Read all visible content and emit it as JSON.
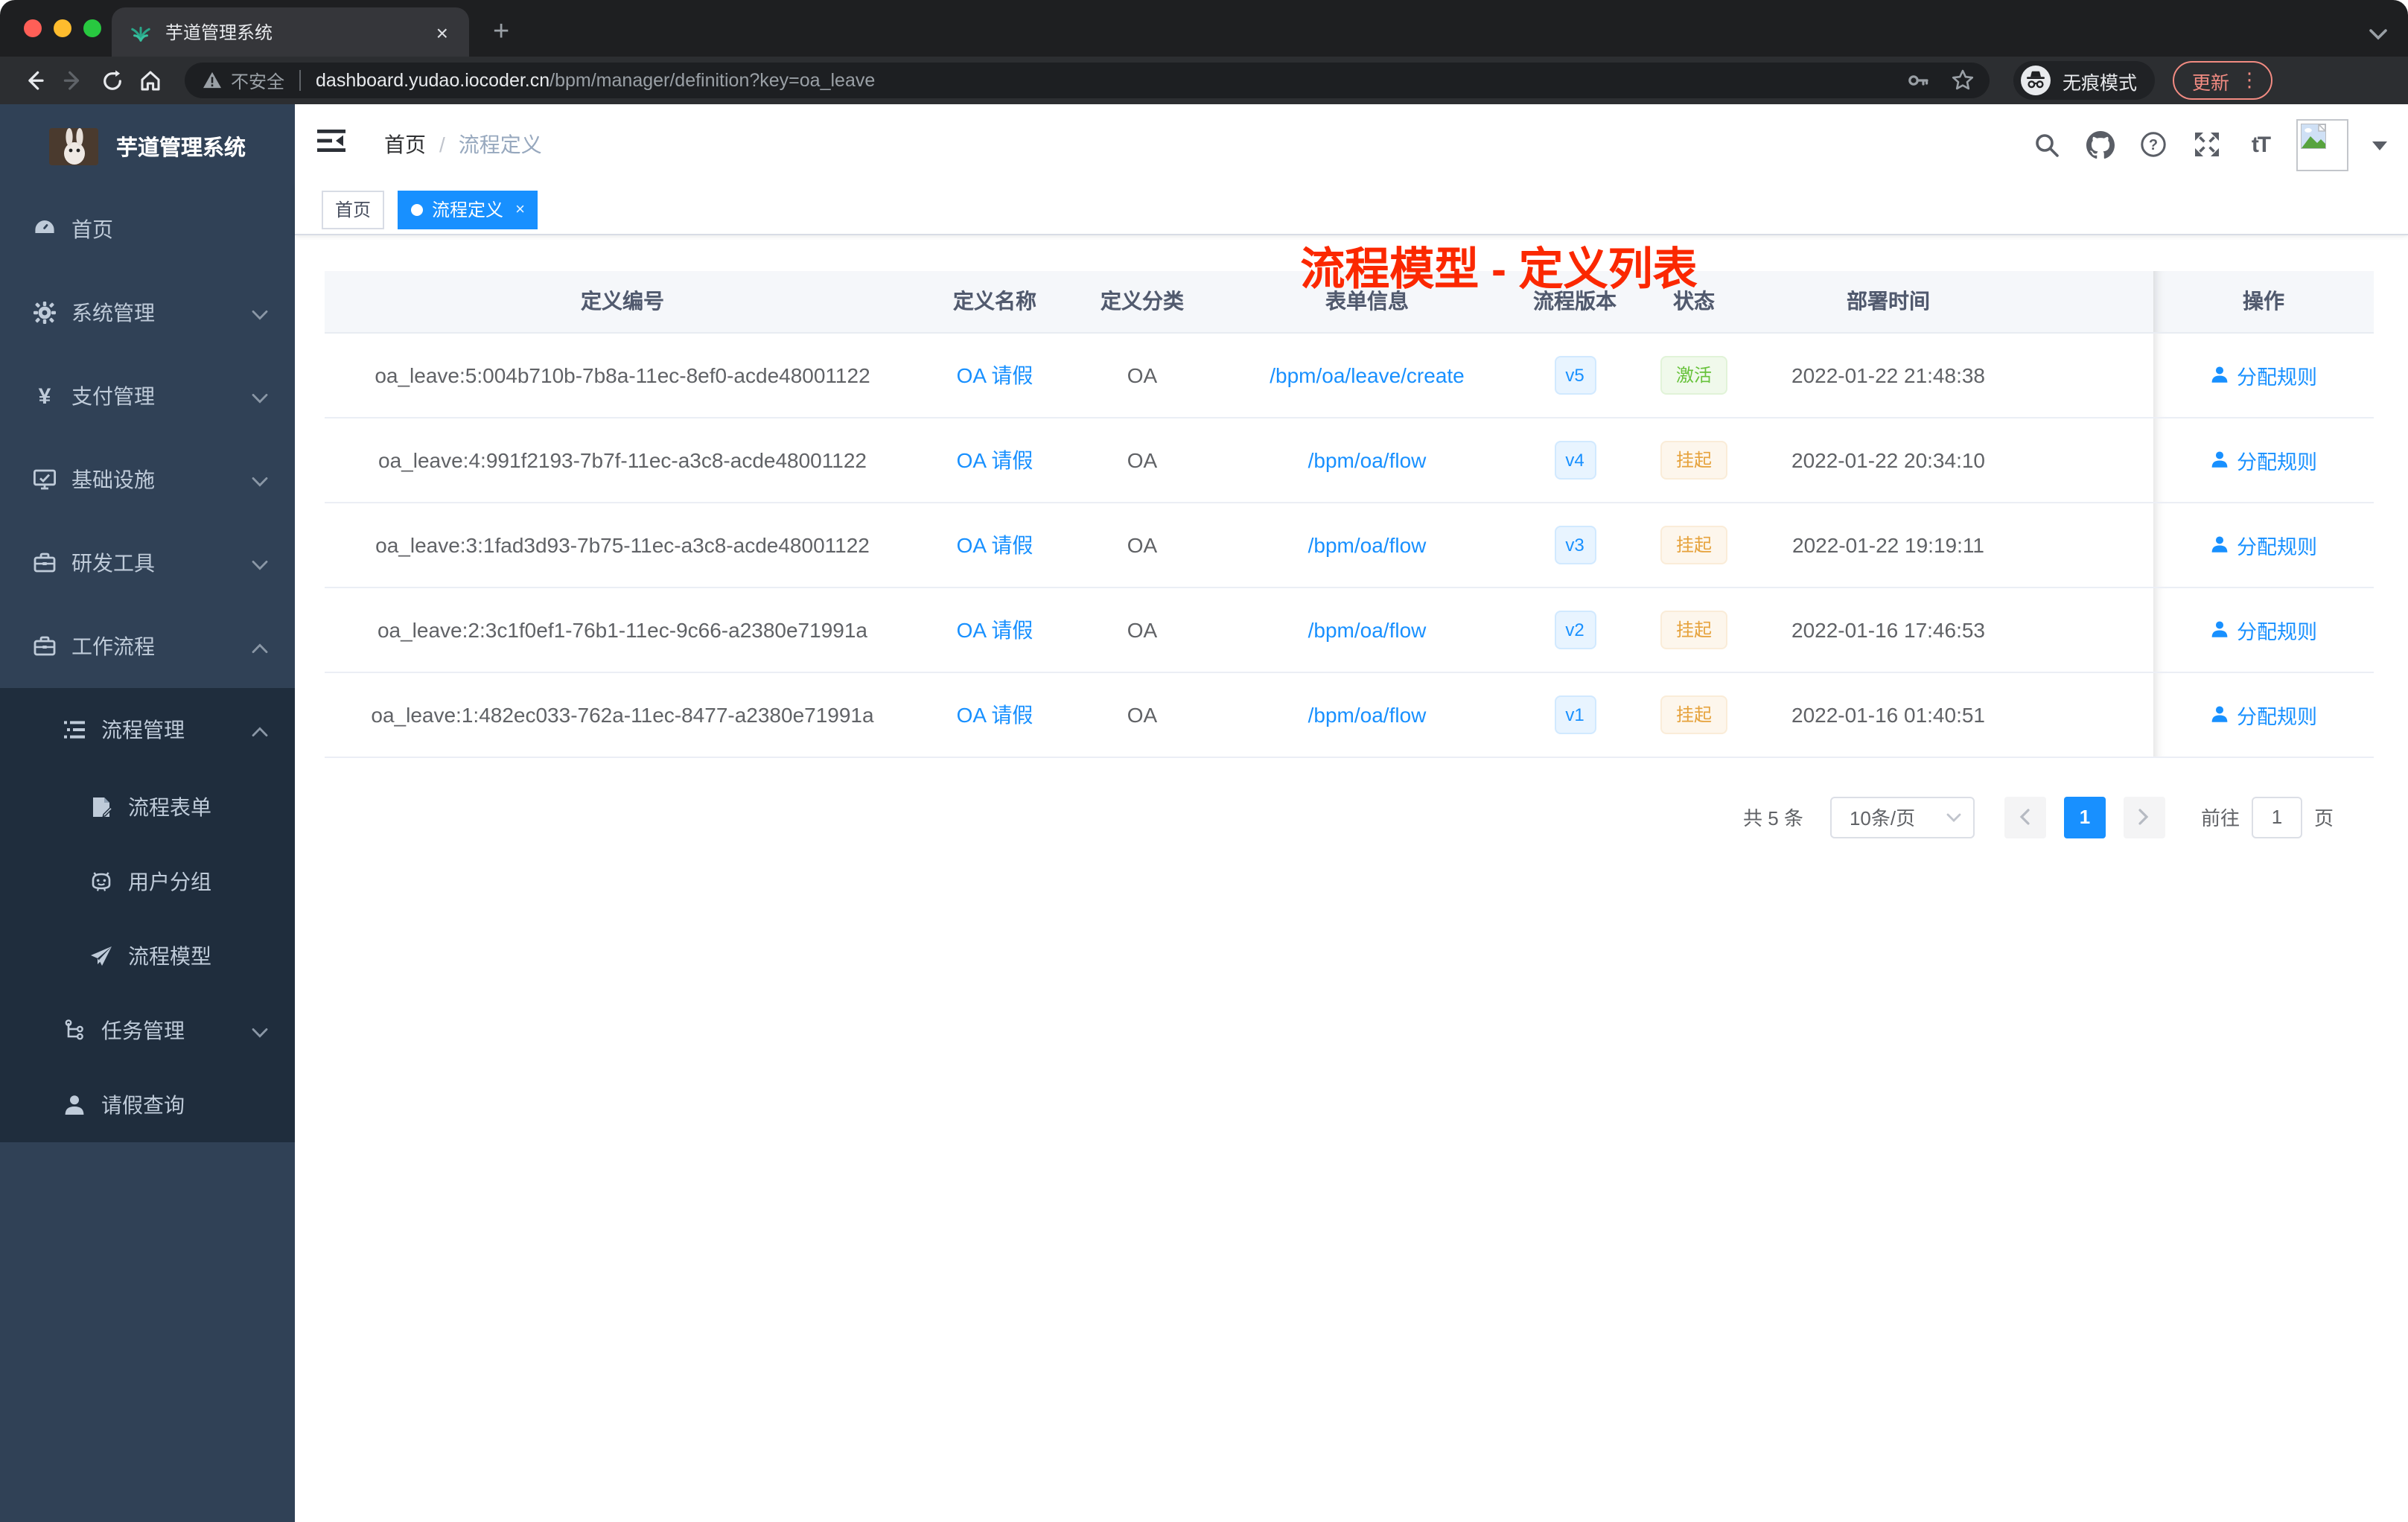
{
  "browser": {
    "tab_title": "芋道管理系统",
    "security_label": "不安全",
    "url_domain": "dashboard.yudao.iocoder.cn",
    "url_path": "/bpm/manager/definition?key=oa_leave",
    "incognito_label": "无痕模式",
    "update_label": "更新"
  },
  "glyphs": {
    "tab_close": "×",
    "new_tab": "+",
    "overflow_dots": "⋮",
    "tag_close": "×",
    "yen": "¥",
    "font_size": "tT"
  },
  "sidebar": {
    "brand": "芋道管理系统",
    "items": [
      {
        "label": "首页",
        "icon": "dashboard-icon"
      },
      {
        "label": "系统管理",
        "icon": "gear-icon"
      },
      {
        "label": "支付管理",
        "icon": "yen-icon"
      },
      {
        "label": "基础设施",
        "icon": "monitor-icon"
      },
      {
        "label": "研发工具",
        "icon": "toolbox-icon"
      },
      {
        "label": "工作流程",
        "icon": "toolbox-icon",
        "expanded": true
      },
      {
        "label": "流程管理",
        "icon": "tree-table-icon",
        "expanded": true
      },
      {
        "label": "流程表单",
        "icon": "form-icon"
      },
      {
        "label": "用户分组",
        "icon": "robot-icon"
      },
      {
        "label": "流程模型",
        "icon": "paper-plane-icon"
      },
      {
        "label": "任务管理",
        "icon": "tree-icon"
      },
      {
        "label": "请假查询",
        "icon": "user-icon"
      }
    ]
  },
  "header": {
    "breadcrumb_home": "首页",
    "breadcrumb_sep": "/",
    "breadcrumb_current": "流程定义",
    "annotation": "流程模型 - 定义列表"
  },
  "tags": {
    "home": "首页",
    "active": "流程定义"
  },
  "table": {
    "headers": [
      "定义编号",
      "定义名称",
      "定义分类",
      "表单信息",
      "流程版本",
      "状态",
      "部署时间",
      "操作"
    ],
    "rows": [
      {
        "id": "oa_leave:5:004b710b-7b8a-11ec-8ef0-acde48001122",
        "name": "OA 请假",
        "category": "OA",
        "form": "/bpm/oa/leave/create",
        "version": "v5",
        "status": "激活",
        "status_type": "success",
        "time": "2022-01-22 21:48:38",
        "action": "分配规则"
      },
      {
        "id": "oa_leave:4:991f2193-7b7f-11ec-a3c8-acde48001122",
        "name": "OA 请假",
        "category": "OA",
        "form": "/bpm/oa/flow",
        "version": "v4",
        "status": "挂起",
        "status_type": "warning",
        "time": "2022-01-22 20:34:10",
        "action": "分配规则"
      },
      {
        "id": "oa_leave:3:1fad3d93-7b75-11ec-a3c8-acde48001122",
        "name": "OA 请假",
        "category": "OA",
        "form": "/bpm/oa/flow",
        "version": "v3",
        "status": "挂起",
        "status_type": "warning",
        "time": "2022-01-22 19:19:11",
        "action": "分配规则"
      },
      {
        "id": "oa_leave:2:3c1f0ef1-76b1-11ec-9c66-a2380e71991a",
        "name": "OA 请假",
        "category": "OA",
        "form": "/bpm/oa/flow",
        "version": "v2",
        "status": "挂起",
        "status_type": "warning",
        "time": "2022-01-16 17:46:53",
        "action": "分配规则"
      },
      {
        "id": "oa_leave:1:482ec033-762a-11ec-8477-a2380e71991a",
        "name": "OA 请假",
        "category": "OA",
        "form": "/bpm/oa/flow",
        "version": "v1",
        "status": "挂起",
        "status_type": "warning",
        "time": "2022-01-16 01:40:51",
        "action": "分配规则"
      }
    ]
  },
  "pagination": {
    "total": "共 5 条",
    "page_size": "10条/页",
    "current_page": "1",
    "goto_label": "前往",
    "goto_value": "1",
    "page_unit": "页"
  },
  "colors": {
    "primary": "#1890ff",
    "success": "#67c23a",
    "warning": "#e6a23c",
    "annotation_red": "#fb2800",
    "sidebar_bg": "#304156",
    "submenu_bg": "#1f2d3d",
    "update_accent": "#f28b82"
  }
}
